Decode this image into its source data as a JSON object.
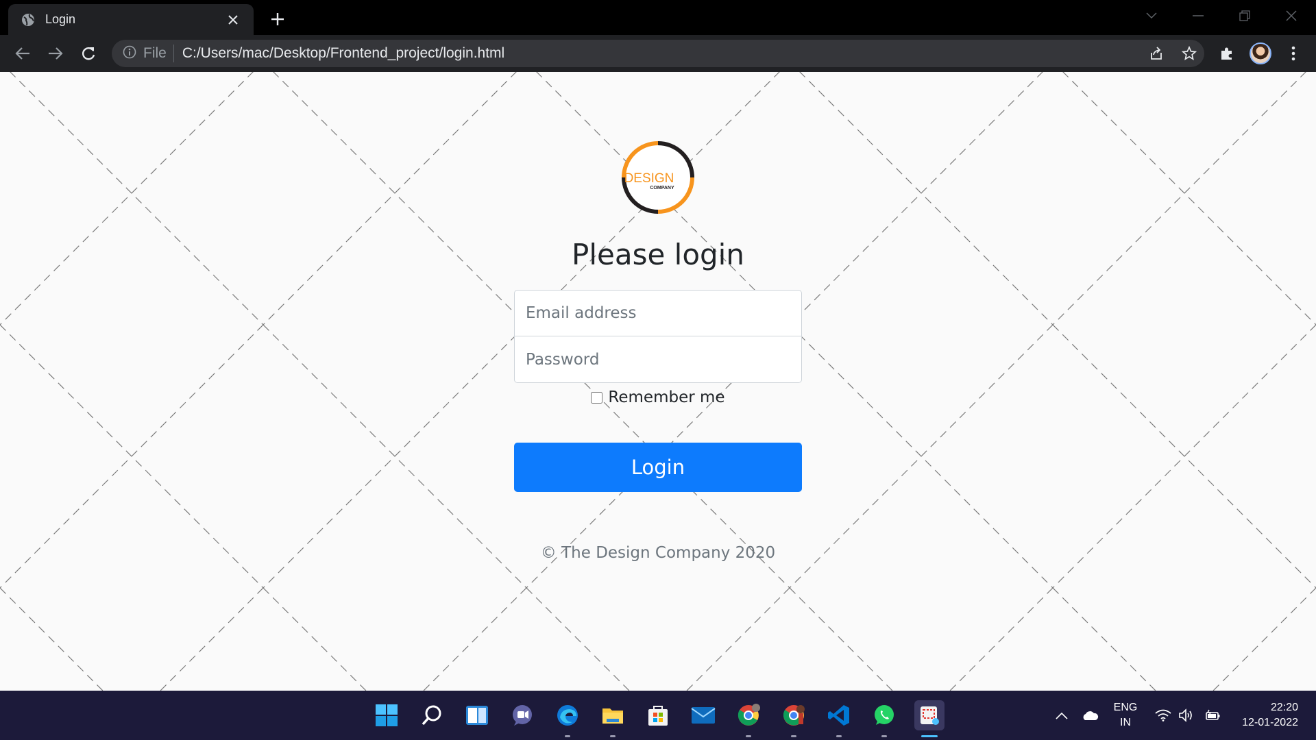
{
  "browser": {
    "tab_title": "Login",
    "address_scheme": "File",
    "address_url": "C:/Users/mac/Desktop/Frontend_project/login.html",
    "icons": [
      "globe-icon",
      "close-icon",
      "plus-icon",
      "chevron-down-icon",
      "minimize-icon",
      "restore-icon",
      "window-close-icon",
      "back-icon",
      "forward-icon",
      "reload-icon",
      "info-icon",
      "share-icon",
      "star-icon",
      "extensions-icon",
      "avatar",
      "more-icon"
    ]
  },
  "page": {
    "logo": {
      "main": "DESIGN",
      "sub": "COMPANY"
    },
    "heading": "Please login",
    "email_placeholder": "Email address",
    "password_placeholder": "Password",
    "remember_label": "Remember me",
    "login_button": "Login",
    "footer": "© The Design Company 2020",
    "colors": {
      "primary": "#0d7bfd",
      "logo_orange": "#f7941d",
      "logo_dark": "#231f20"
    }
  },
  "taskbar": {
    "apps": [
      "start-icon",
      "search-icon",
      "widgets-icon",
      "chat-icon",
      "edge-icon",
      "file-explorer-icon",
      "store-icon",
      "mail-icon",
      "chrome-icon",
      "chrome-profile-icon",
      "vscode-icon",
      "whatsapp-icon",
      "snipping-tool-icon"
    ],
    "lang_line1": "ENG",
    "lang_line2": "IN",
    "time": "22:20",
    "date": "12-01-2022"
  }
}
